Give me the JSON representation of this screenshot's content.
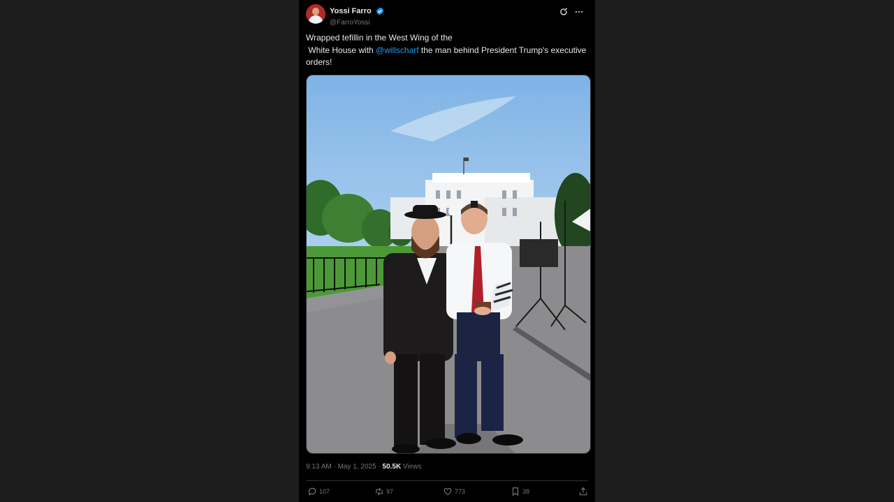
{
  "post": {
    "author": {
      "display_name": "Yossi Farro",
      "handle": "@FarroYossi",
      "verified": true,
      "avatar_color": "#b22a2a"
    },
    "text": {
      "part1": "Wrapped tefillin in the West Wing of the\n White House with ",
      "mention": "@willscharf",
      "part2": " the man behind President Trump's executive orders!"
    },
    "meta": {
      "time": "9:13 AM",
      "separator": " · ",
      "date": "May 1, 2025",
      "views_count": "50.5K",
      "views_label": "Views"
    },
    "actions": {
      "replies": "107",
      "reposts": "97",
      "likes": "773",
      "bookmarks": "38"
    }
  },
  "colors": {
    "background": "#1d1d1d",
    "card": "#000000",
    "accent": "#1d9bf0",
    "muted": "#71767b"
  },
  "icons": [
    "verified-badge-icon",
    "grok-icon",
    "more-icon",
    "reply-icon",
    "repost-icon",
    "like-icon",
    "bookmark-icon",
    "share-icon"
  ]
}
